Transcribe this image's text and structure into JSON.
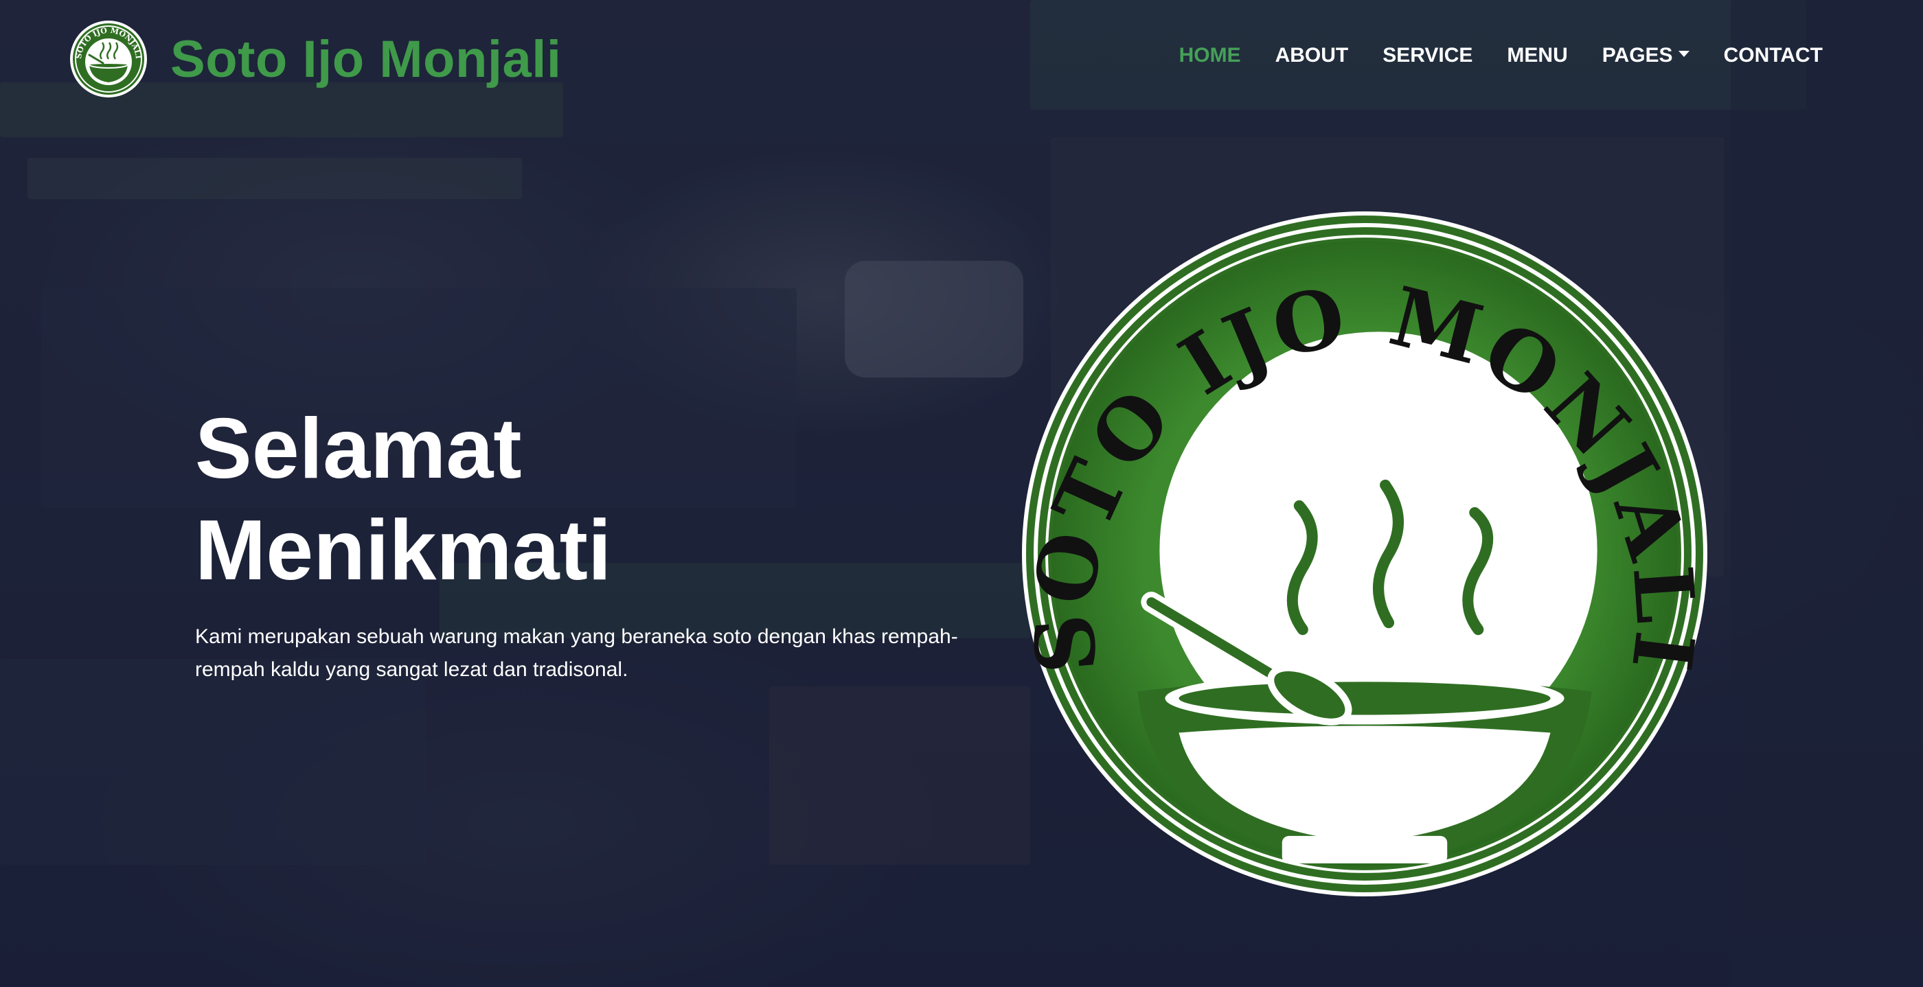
{
  "brand": {
    "name": "Soto Ijo Monjali",
    "logo_text": "SOTO IJO MONJALI",
    "logo_icon": "soup-bowl-icon",
    "brand_color": "#3f9a4a"
  },
  "nav": {
    "items": [
      {
        "label": "HOME",
        "active": true
      },
      {
        "label": "ABOUT",
        "active": false
      },
      {
        "label": "SERVICE",
        "active": false
      },
      {
        "label": "MENU",
        "active": false
      },
      {
        "label": "PAGES",
        "active": false,
        "dropdown": true
      },
      {
        "label": "CONTACT",
        "active": false
      }
    ],
    "active_color": "#45a158",
    "dropdown_icon": "caret-down-icon"
  },
  "hero": {
    "title_line1": "Selamat",
    "title_line2": "Menikmati",
    "description": "Kami merupakan sebuah warung makan yang beraneka soto dengan khas rempah-rempah kaldu yang sangat lezat dan tradisonal."
  },
  "emblem": {
    "text": "SOTO IJO MONJALI",
    "icon": "steaming-soup-bowl-icon",
    "color": "#2f6e22"
  },
  "colors": {
    "overlay": "#161b34",
    "text": "#ffffff"
  }
}
